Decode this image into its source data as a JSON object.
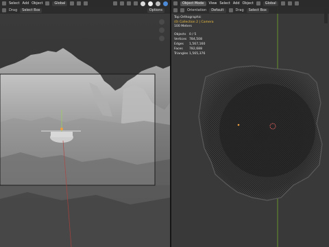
{
  "left_viewport": {
    "header": {
      "menus": [
        "Select",
        "Add",
        "Object"
      ],
      "transform_orientation": "Global",
      "options_label": "Options"
    },
    "tool_header": {
      "drag_label": "Drag",
      "drag_value": "Select Box"
    }
  },
  "right_viewport": {
    "header": {
      "mode": "Object Mode",
      "menus": [
        "View",
        "Select",
        "Add",
        "Object"
      ],
      "transform_orientation": "Global"
    },
    "tool_header": {
      "orientation_label": "Orientation",
      "orientation_value": "Default",
      "drag_label": "Drag",
      "drag_value": "Select Box"
    },
    "overlay": {
      "view_name": "Top Orthographic",
      "collection": "(0) Collection 2 | Camera",
      "scale": "100 Meters"
    },
    "stats": [
      {
        "label": "Objects",
        "value": "0 / 5"
      },
      {
        "label": "Vertices",
        "value": "784,508"
      },
      {
        "label": "Edges",
        "value": "1,567,160"
      },
      {
        "label": "Faces",
        "value": "782,688"
      },
      {
        "label": "Triangles",
        "value": "1,565,376"
      }
    ]
  },
  "colors": {
    "viewport_bg": "#3d3d3d",
    "header_bg": "#2b2b2b",
    "axis_green": "#6e9c2a",
    "axis_red": "#b5413c",
    "origin": "#f0a040",
    "cursor": "#ff6a6a"
  }
}
